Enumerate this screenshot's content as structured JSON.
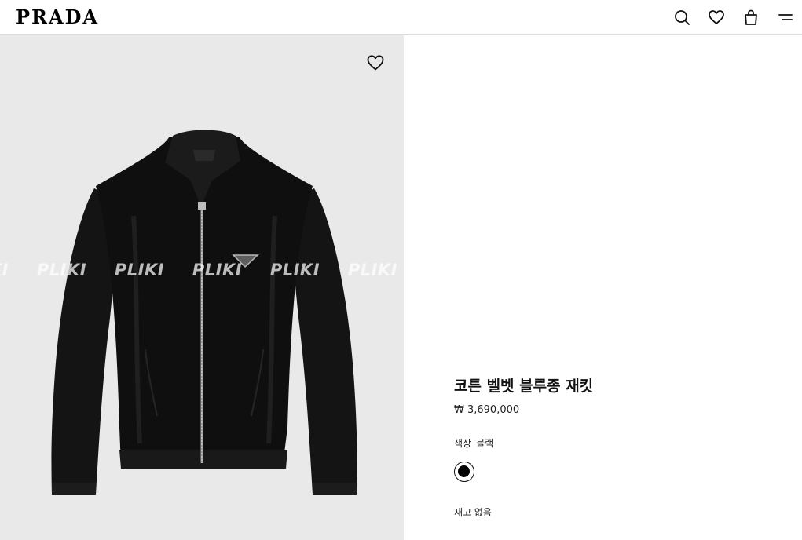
{
  "header": {
    "logo": "PRADA",
    "icons": [
      "search-icon",
      "heart-icon",
      "shopping-bag-icon",
      "menu-icon"
    ]
  },
  "gallery": {
    "background": "#e9e9e9",
    "watermark": "KI PLIKI PLIKI PLIKI PLIKI PLIKI",
    "wishlist_icon": "heart-outline-icon"
  },
  "product": {
    "title": "코튼 벨벳 블루종 재킷",
    "price": "₩ 3,690,000",
    "color_label": "색상",
    "color_value": "블랙",
    "swatch_color": "#000000",
    "stock_status": "재고 없음"
  }
}
